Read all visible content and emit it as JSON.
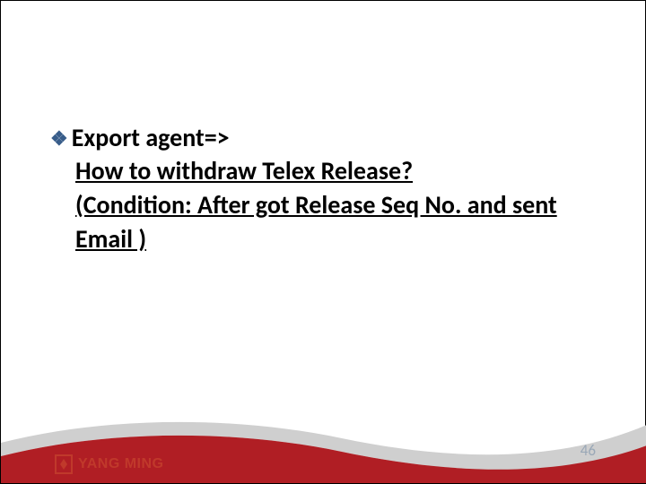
{
  "content": {
    "bullet_label": "Export agent=>",
    "line2": "How to withdraw Telex Release?",
    "line3": "(Condition: After got Release Seq No. and sent Email )"
  },
  "footer": {
    "logo_text": "YANG MING",
    "page_number": "46"
  },
  "icons": {
    "bullet": "❖"
  }
}
